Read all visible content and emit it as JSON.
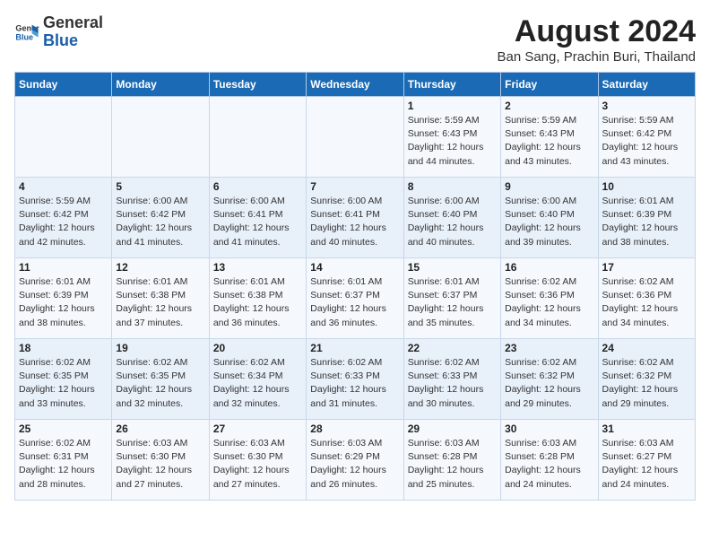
{
  "logo": {
    "line1": "General",
    "line2": "Blue"
  },
  "title": "August 2024",
  "subtitle": "Ban Sang, Prachin Buri, Thailand",
  "headers": [
    "Sunday",
    "Monday",
    "Tuesday",
    "Wednesday",
    "Thursday",
    "Friday",
    "Saturday"
  ],
  "weeks": [
    [
      {
        "day": "",
        "info": ""
      },
      {
        "day": "",
        "info": ""
      },
      {
        "day": "",
        "info": ""
      },
      {
        "day": "",
        "info": ""
      },
      {
        "day": "1",
        "info": "Sunrise: 5:59 AM\nSunset: 6:43 PM\nDaylight: 12 hours\nand 44 minutes."
      },
      {
        "day": "2",
        "info": "Sunrise: 5:59 AM\nSunset: 6:43 PM\nDaylight: 12 hours\nand 43 minutes."
      },
      {
        "day": "3",
        "info": "Sunrise: 5:59 AM\nSunset: 6:42 PM\nDaylight: 12 hours\nand 43 minutes."
      }
    ],
    [
      {
        "day": "4",
        "info": "Sunrise: 5:59 AM\nSunset: 6:42 PM\nDaylight: 12 hours\nand 42 minutes."
      },
      {
        "day": "5",
        "info": "Sunrise: 6:00 AM\nSunset: 6:42 PM\nDaylight: 12 hours\nand 41 minutes."
      },
      {
        "day": "6",
        "info": "Sunrise: 6:00 AM\nSunset: 6:41 PM\nDaylight: 12 hours\nand 41 minutes."
      },
      {
        "day": "7",
        "info": "Sunrise: 6:00 AM\nSunset: 6:41 PM\nDaylight: 12 hours\nand 40 minutes."
      },
      {
        "day": "8",
        "info": "Sunrise: 6:00 AM\nSunset: 6:40 PM\nDaylight: 12 hours\nand 40 minutes."
      },
      {
        "day": "9",
        "info": "Sunrise: 6:00 AM\nSunset: 6:40 PM\nDaylight: 12 hours\nand 39 minutes."
      },
      {
        "day": "10",
        "info": "Sunrise: 6:01 AM\nSunset: 6:39 PM\nDaylight: 12 hours\nand 38 minutes."
      }
    ],
    [
      {
        "day": "11",
        "info": "Sunrise: 6:01 AM\nSunset: 6:39 PM\nDaylight: 12 hours\nand 38 minutes."
      },
      {
        "day": "12",
        "info": "Sunrise: 6:01 AM\nSunset: 6:38 PM\nDaylight: 12 hours\nand 37 minutes."
      },
      {
        "day": "13",
        "info": "Sunrise: 6:01 AM\nSunset: 6:38 PM\nDaylight: 12 hours\nand 36 minutes."
      },
      {
        "day": "14",
        "info": "Sunrise: 6:01 AM\nSunset: 6:37 PM\nDaylight: 12 hours\nand 36 minutes."
      },
      {
        "day": "15",
        "info": "Sunrise: 6:01 AM\nSunset: 6:37 PM\nDaylight: 12 hours\nand 35 minutes."
      },
      {
        "day": "16",
        "info": "Sunrise: 6:02 AM\nSunset: 6:36 PM\nDaylight: 12 hours\nand 34 minutes."
      },
      {
        "day": "17",
        "info": "Sunrise: 6:02 AM\nSunset: 6:36 PM\nDaylight: 12 hours\nand 34 minutes."
      }
    ],
    [
      {
        "day": "18",
        "info": "Sunrise: 6:02 AM\nSunset: 6:35 PM\nDaylight: 12 hours\nand 33 minutes."
      },
      {
        "day": "19",
        "info": "Sunrise: 6:02 AM\nSunset: 6:35 PM\nDaylight: 12 hours\nand 32 minutes."
      },
      {
        "day": "20",
        "info": "Sunrise: 6:02 AM\nSunset: 6:34 PM\nDaylight: 12 hours\nand 32 minutes."
      },
      {
        "day": "21",
        "info": "Sunrise: 6:02 AM\nSunset: 6:33 PM\nDaylight: 12 hours\nand 31 minutes."
      },
      {
        "day": "22",
        "info": "Sunrise: 6:02 AM\nSunset: 6:33 PM\nDaylight: 12 hours\nand 30 minutes."
      },
      {
        "day": "23",
        "info": "Sunrise: 6:02 AM\nSunset: 6:32 PM\nDaylight: 12 hours\nand 29 minutes."
      },
      {
        "day": "24",
        "info": "Sunrise: 6:02 AM\nSunset: 6:32 PM\nDaylight: 12 hours\nand 29 minutes."
      }
    ],
    [
      {
        "day": "25",
        "info": "Sunrise: 6:02 AM\nSunset: 6:31 PM\nDaylight: 12 hours\nand 28 minutes."
      },
      {
        "day": "26",
        "info": "Sunrise: 6:03 AM\nSunset: 6:30 PM\nDaylight: 12 hours\nand 27 minutes."
      },
      {
        "day": "27",
        "info": "Sunrise: 6:03 AM\nSunset: 6:30 PM\nDaylight: 12 hours\nand 27 minutes."
      },
      {
        "day": "28",
        "info": "Sunrise: 6:03 AM\nSunset: 6:29 PM\nDaylight: 12 hours\nand 26 minutes."
      },
      {
        "day": "29",
        "info": "Sunrise: 6:03 AM\nSunset: 6:28 PM\nDaylight: 12 hours\nand 25 minutes."
      },
      {
        "day": "30",
        "info": "Sunrise: 6:03 AM\nSunset: 6:28 PM\nDaylight: 12 hours\nand 24 minutes."
      },
      {
        "day": "31",
        "info": "Sunrise: 6:03 AM\nSunset: 6:27 PM\nDaylight: 12 hours\nand 24 minutes."
      }
    ]
  ]
}
